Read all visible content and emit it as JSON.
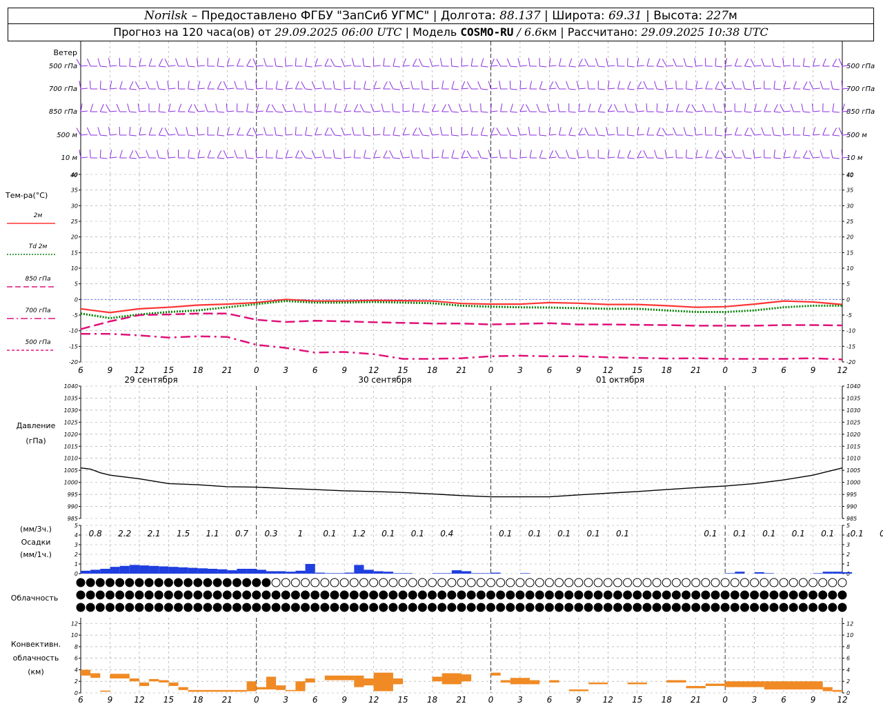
{
  "header": {
    "station": "Norilsk",
    "sep1": " – Предоставлено ФГБУ \"ЗапСиб УГМС\" | Долгота: ",
    "lon": "88.137",
    "sep2": " | Широта: ",
    "lat": "69.31",
    "sep3": " | Высота: ",
    "alt": "227",
    "alt_unit": "м",
    "line2_a": "Прогноз на 120 часа(ов) от ",
    "run": "29.09.2025 06:00 UTC",
    "line2_b": "  | Модель ",
    "model": "COSMO-RU",
    "line2_c": " / ",
    "res": "6.6",
    "line2_d": "км | Рассчитано: ",
    "calc": "29.09.2025 10:38 UTC"
  },
  "wind_panel": {
    "title": "Ветер",
    "levels": [
      "500 гПа",
      "700 гПа",
      "850 гПа",
      "500 м",
      "10  м"
    ]
  },
  "temp_panel": {
    "title": "Тем-ра(°C)",
    "legend": [
      {
        "label": "2м",
        "color": "#ff3333",
        "style": "solid"
      },
      {
        "label": "Td  2м",
        "color": "#008000",
        "style": "dotted"
      },
      {
        "label": "850 гПа",
        "color": "#e0107a",
        "style": "dash"
      },
      {
        "label": "700 гПа",
        "color": "#e0107a",
        "style": "dash-dot"
      },
      {
        "label": "500 гПа",
        "color": "#e0107a",
        "style": "dash-fine"
      }
    ],
    "yticks": [
      40,
      35,
      30,
      25,
      20,
      15,
      10,
      5,
      0,
      -5,
      -10,
      -15,
      -20
    ]
  },
  "time_axis": {
    "hour_labels": [
      "6",
      "9",
      "12",
      "15",
      "18",
      "21",
      "0",
      "3",
      "6",
      "9",
      "12",
      "15",
      "18",
      "21",
      "0",
      "3",
      "6",
      "9",
      "12",
      "15",
      "18",
      "21",
      "0",
      "3",
      "6",
      "9",
      "12"
    ],
    "dates": [
      "29 сентября",
      "30 сентября",
      "01 октября"
    ]
  },
  "pressure_panel": {
    "title": "Давление",
    "unit": "(гПа)",
    "yticks": [
      1040,
      1035,
      1030,
      1025,
      1020,
      1015,
      1010,
      1005,
      1000,
      995,
      990,
      985
    ]
  },
  "precip_panel": {
    "unit3": "(мм/3ч.)",
    "title": "Осадки",
    "unit1": "(мм/1ч.)",
    "yticks": [
      5,
      4,
      3,
      2,
      1,
      0
    ],
    "amounts": [
      {
        "hour": 3,
        "value": "0.8"
      },
      {
        "hour": 6,
        "value": "2.2"
      },
      {
        "hour": 9,
        "value": "2.1"
      },
      {
        "hour": 12,
        "value": "1.5"
      },
      {
        "hour": 15,
        "value": "1.1"
      },
      {
        "hour": 18,
        "value": "0.7"
      },
      {
        "hour": 21,
        "value": "0.3"
      },
      {
        "hour": 24,
        "value": "1"
      },
      {
        "hour": 27,
        "value": "0.1"
      },
      {
        "hour": 30,
        "value": "1.2"
      },
      {
        "hour": 33,
        "value": "0.1"
      },
      {
        "hour": 36,
        "value": "0.1"
      },
      {
        "hour": 39,
        "value": "0.4"
      },
      {
        "hour": 45,
        "value": "0.1"
      },
      {
        "hour": 48,
        "value": "0.1"
      },
      {
        "hour": 51,
        "value": "0.1"
      },
      {
        "hour": 54,
        "value": "0.1"
      },
      {
        "hour": 57,
        "value": "0.1"
      },
      {
        "hour": 66,
        "value": "0.1"
      },
      {
        "hour": 69,
        "value": "0.1"
      },
      {
        "hour": 72,
        "value": "0.1"
      },
      {
        "hour": 75,
        "value": "0.1"
      },
      {
        "hour": 78,
        "value": "0.1"
      },
      {
        "hour": 81,
        "value": "0.1"
      },
      {
        "hour": 84,
        "value": "0.1"
      }
    ]
  },
  "cloud_panel": {
    "title": "Облачность"
  },
  "conv_panel": {
    "title1": "Конвективн.",
    "title2": "облачность",
    "unit": "(км)",
    "yticks": [
      12,
      10,
      8,
      6,
      4,
      2,
      0
    ]
  },
  "colors": {
    "wind": "#8a2be2",
    "t2m": "#ff3333",
    "td2m": "#008000",
    "upper": "#e0107a",
    "pressure": "#000000",
    "precip": "#1f3fdf",
    "conv": "#f08a24",
    "grid": "#999999"
  },
  "chart_data": [
    {
      "type": "line",
      "title": "Тем-ра(°C)",
      "x_unit": "hours from 29.09.2025 06:00 UTC",
      "ylim": [
        -20,
        40
      ],
      "x": [
        0,
        3,
        6,
        9,
        12,
        15,
        18,
        21,
        24,
        27,
        30,
        33,
        36,
        39,
        42,
        45,
        48,
        51,
        54,
        57,
        60,
        63,
        66,
        69,
        72,
        75,
        78
      ],
      "series": [
        {
          "name": "2м",
          "values": [
            -3,
            -4.2,
            -3,
            -2.5,
            -1.8,
            -1.5,
            -1,
            0,
            -0.5,
            -0.5,
            -0.3,
            -0.4,
            -0.5,
            -1.3,
            -1.5,
            -1.5,
            -1,
            -1.2,
            -1.6,
            -1.6,
            -2,
            -2.5,
            -2.3,
            -1.5,
            -0.5,
            -0.8,
            -1.6
          ]
        },
        {
          "name": "Td  2м",
          "values": [
            -4.5,
            -6,
            -4.8,
            -4,
            -3.5,
            -2.5,
            -1.5,
            -0.5,
            -1,
            -1,
            -0.8,
            -1,
            -1.2,
            -2,
            -2.3,
            -2.5,
            -2.6,
            -2.8,
            -3,
            -3,
            -3.5,
            -4,
            -4,
            -3.5,
            -2.5,
            -2,
            -2
          ]
        },
        {
          "name": "850 гПа",
          "values": [
            -9.5,
            -7,
            -5,
            -4.8,
            -4.5,
            -4.5,
            -6.5,
            -7.2,
            -6.8,
            -7,
            -7.3,
            -7.5,
            -7.7,
            -7.7,
            -8,
            -7.8,
            -7.6,
            -8,
            -8,
            -8.1,
            -8.2,
            -8.4,
            -8.4,
            -8.4,
            -8.2,
            -8.2,
            -8.3
          ]
        },
        {
          "name": "700 гПа",
          "values": [
            -11,
            -11,
            -11.5,
            -12.2,
            -11.8,
            -12,
            -14.5,
            -15.5,
            -17,
            -16.8,
            -17.5,
            -19,
            -19,
            -18.8,
            -18.2,
            -18,
            -18.2,
            -18.2,
            -18.5,
            -18.7,
            -18.9,
            -18.8,
            -19,
            -19,
            -19,
            -18.8,
            -19.2
          ]
        }
      ]
    },
    {
      "type": "line",
      "title": "Давление",
      "x_unit": "hours from 29.09.2025 06:00 UTC",
      "ylim": [
        985,
        1040
      ],
      "x": [
        0,
        1,
        2,
        3,
        6,
        9,
        12,
        15,
        18,
        21,
        24,
        27,
        30,
        33,
        36,
        39,
        42,
        45,
        48,
        51,
        54,
        57,
        60,
        63,
        66,
        69,
        72,
        75,
        78
      ],
      "values": [
        1006,
        1005.5,
        1004,
        1003,
        1001.5,
        999.5,
        999,
        998.2,
        998,
        997.5,
        997,
        996.5,
        996.2,
        995.8,
        995.2,
        994.5,
        994,
        994,
        994,
        994.8,
        995.5,
        996.2,
        997,
        997.8,
        998.5,
        999.5,
        1001,
        1003,
        1006
      ],
      "ylabel": "(гПа)"
    },
    {
      "type": "bar",
      "title": "Осадки",
      "x_unit": "hour",
      "ylabel": "(мм/1ч.)",
      "ylim": [
        0,
        5
      ],
      "x": [
        0,
        1,
        2,
        3,
        4,
        5,
        6,
        7,
        8,
        9,
        10,
        11,
        12,
        13,
        14,
        15,
        16,
        17,
        18,
        19,
        20,
        21,
        22,
        23,
        24,
        25,
        26,
        27,
        28,
        29,
        30,
        31,
        32,
        33,
        36,
        37,
        38,
        39,
        40,
        41,
        42,
        45,
        66,
        67,
        69,
        70,
        75,
        76,
        77,
        78
      ],
      "values": [
        0.3,
        0.4,
        0.5,
        0.7,
        0.8,
        0.9,
        0.85,
        0.8,
        0.75,
        0.7,
        0.65,
        0.6,
        0.55,
        0.5,
        0.45,
        0.35,
        0.5,
        0.5,
        0.4,
        0.25,
        0.25,
        0.2,
        0.3,
        1.0,
        0.1,
        0.05,
        0.05,
        0.1,
        0.9,
        0.4,
        0.25,
        0.2,
        0.05,
        0.05,
        0.05,
        0.05,
        0.35,
        0.25,
        0.05,
        0.05,
        0.1,
        0.05,
        0.05,
        0.2,
        0.15,
        0.05,
        0.05,
        0.2,
        0.2,
        0.15
      ]
    },
    {
      "type": "bar",
      "title": "Конвективн. облачность",
      "ylabel": "(км)",
      "ylim": [
        0,
        13
      ],
      "bars": [
        {
          "x0": 0,
          "x1": 1,
          "bottom": 3.0,
          "top": 4.0
        },
        {
          "x0": 1,
          "x1": 2,
          "bottom": 2.6,
          "top": 3.4
        },
        {
          "x0": 2,
          "x1": 3,
          "bottom": 0.2,
          "top": 0.4
        },
        {
          "x0": 3,
          "x1": 5,
          "bottom": 2.5,
          "top": 3.3
        },
        {
          "x0": 5,
          "x1": 6,
          "bottom": 2.0,
          "top": 2.5
        },
        {
          "x0": 6,
          "x1": 7,
          "bottom": 1.2,
          "top": 1.8
        },
        {
          "x0": 7,
          "x1": 8,
          "bottom": 2.0,
          "top": 2.4
        },
        {
          "x0": 8,
          "x1": 9,
          "bottom": 1.8,
          "top": 2.2
        },
        {
          "x0": 9,
          "x1": 10,
          "bottom": 1.2,
          "top": 1.8
        },
        {
          "x0": 10,
          "x1": 11,
          "bottom": 0.5,
          "top": 1.0
        },
        {
          "x0": 11,
          "x1": 17,
          "bottom": 0.2,
          "top": 0.5
        },
        {
          "x0": 17,
          "x1": 18,
          "bottom": 0.3,
          "top": 2.0
        },
        {
          "x0": 18,
          "x1": 19,
          "bottom": 0.6,
          "top": 1.0
        },
        {
          "x0": 19,
          "x1": 20,
          "bottom": 0.6,
          "top": 2.8
        },
        {
          "x0": 20,
          "x1": 21,
          "bottom": 0.5,
          "top": 1.3
        },
        {
          "x0": 21,
          "x1": 22,
          "bottom": 0.3,
          "top": 0.5
        },
        {
          "x0": 22,
          "x1": 23,
          "bottom": 0.3,
          "top": 2.0
        },
        {
          "x0": 23,
          "x1": 24,
          "bottom": 1.8,
          "top": 2.5
        },
        {
          "x0": 25,
          "x1": 28,
          "bottom": 2.2,
          "top": 3.0
        },
        {
          "x0": 28,
          "x1": 29,
          "bottom": 1.0,
          "top": 3.0
        },
        {
          "x0": 29,
          "x1": 30,
          "bottom": 1.3,
          "top": 2.5
        },
        {
          "x0": 30,
          "x1": 32,
          "bottom": 0.3,
          "top": 3.5
        },
        {
          "x0": 32,
          "x1": 33,
          "bottom": 1.5,
          "top": 2.5
        },
        {
          "x0": 36,
          "x1": 37,
          "bottom": 2.0,
          "top": 2.8
        },
        {
          "x0": 37,
          "x1": 39,
          "bottom": 1.5,
          "top": 3.4
        },
        {
          "x0": 39,
          "x1": 40,
          "bottom": 2.0,
          "top": 3.2
        },
        {
          "x0": 42,
          "x1": 43,
          "bottom": 3.0,
          "top": 3.5
        },
        {
          "x0": 43,
          "x1": 44,
          "bottom": 1.8,
          "top": 2.2
        },
        {
          "x0": 44,
          "x1": 46,
          "bottom": 1.5,
          "top": 2.6
        },
        {
          "x0": 46,
          "x1": 47,
          "bottom": 1.5,
          "top": 2.2
        },
        {
          "x0": 48,
          "x1": 49,
          "bottom": 1.8,
          "top": 2.2
        },
        {
          "x0": 50,
          "x1": 52,
          "bottom": 0.3,
          "top": 0.6
        },
        {
          "x0": 52,
          "x1": 54,
          "bottom": 1.5,
          "top": 1.8
        },
        {
          "x0": 56,
          "x1": 58,
          "bottom": 1.5,
          "top": 1.8
        },
        {
          "x0": 60,
          "x1": 62,
          "bottom": 1.8,
          "top": 2.2
        },
        {
          "x0": 62,
          "x1": 64,
          "bottom": 0.8,
          "top": 1.2
        },
        {
          "x0": 64,
          "x1": 66,
          "bottom": 1.2,
          "top": 1.6
        },
        {
          "x0": 66,
          "x1": 70,
          "bottom": 1.0,
          "top": 2.0
        },
        {
          "x0": 70,
          "x1": 76,
          "bottom": 0.6,
          "top": 2.0
        },
        {
          "x0": 76,
          "x1": 77,
          "bottom": 0.3,
          "top": 1.0
        },
        {
          "x0": 77,
          "x1": 78,
          "bottom": 0.2,
          "top": 0.5
        }
      ]
    }
  ]
}
